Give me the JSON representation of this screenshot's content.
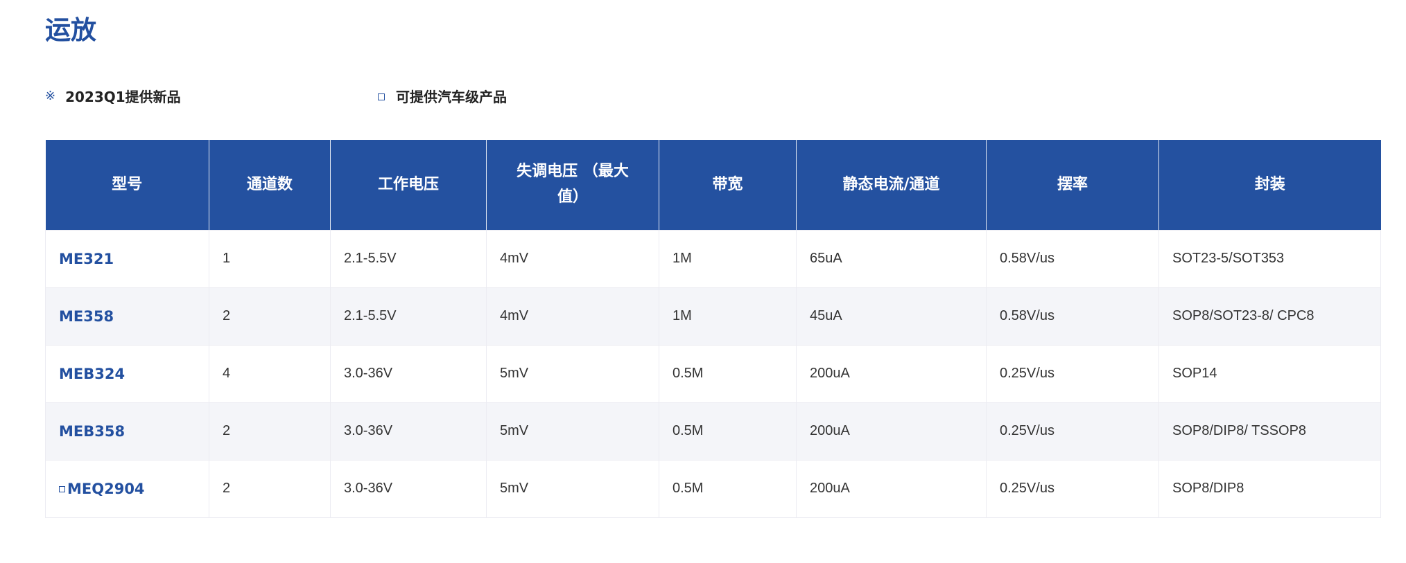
{
  "page": {
    "title": "运放",
    "accent_color": "#2350a0"
  },
  "legend": {
    "new_symbol": "※",
    "new_label": "2023Q1提供新品",
    "auto_symbol": "square-outline-icon",
    "auto_label": "可提供汽车级产品"
  },
  "table": {
    "header_color": "#2451a0",
    "headers": {
      "model": "型号",
      "channels": "通道数",
      "voltage": "工作电压",
      "offset_line1": "失调电压 （最大",
      "offset_line2": "值）",
      "bandwidth": "带宽",
      "quiescent": "静态电流/通道",
      "slew": "摆率",
      "package": "封装"
    },
    "rows": [
      {
        "model": "ME321",
        "channels": "1",
        "voltage": "2.1-5.5V",
        "offset": "4mV",
        "bandwidth": "1M",
        "quiescent": "65uA",
        "slew": "0.58V/us",
        "package": "SOT23-5/SOT353"
      },
      {
        "model": "ME358",
        "channels": "2",
        "voltage": "2.1-5.5V",
        "offset": "4mV",
        "bandwidth": "1M",
        "quiescent": "45uA",
        "slew": "0.58V/us",
        "package": "SOP8/SOT23-8/ CPC8"
      },
      {
        "model": "MEB324",
        "channels": "4",
        "voltage": "3.0-36V",
        "offset": "5mV",
        "bandwidth": "0.5M",
        "quiescent": "200uA",
        "slew": "0.25V/us",
        "package": "SOP14"
      },
      {
        "model": "MEB358",
        "channels": "2",
        "voltage": "3.0-36V",
        "offset": "5mV",
        "bandwidth": "0.5M",
        "quiescent": "200uA",
        "slew": "0.25V/us",
        "package": "SOP8/DIP8/ TSSOP8"
      },
      {
        "model": "MEQ2904",
        "automotive": true,
        "channels": "2",
        "voltage": "3.0-36V",
        "offset": "5mV",
        "bandwidth": "0.5M",
        "quiescent": "200uA",
        "slew": "0.25V/us",
        "package": "SOP8/DIP8"
      }
    ]
  }
}
